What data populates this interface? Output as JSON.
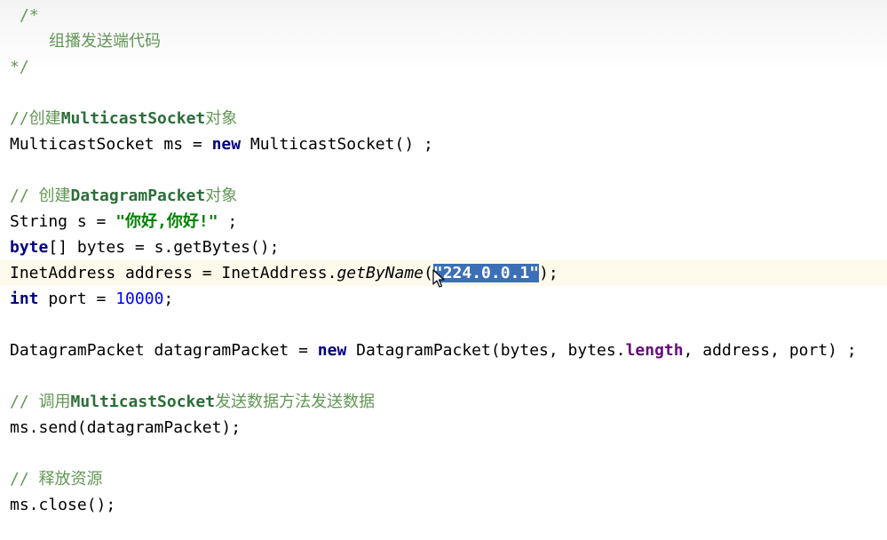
{
  "code": {
    "l1": "/*",
    "l2": "组播发送端代码",
    "l3": "*/",
    "l4_prefix": "//创建",
    "l4_id": "MulticastSocket",
    "l4_suffix": "对象",
    "l5_a": "MulticastSocket ms = ",
    "l5_kw": "new",
    "l5_b": " MulticastSocket() ;",
    "l6_prefix": "// 创建",
    "l6_id": "DatagramPacket",
    "l6_suffix": "对象",
    "l7_a": "String s = ",
    "l7_str": "\"你好,你好!\"",
    "l7_b": " ;",
    "l8_kw": "byte",
    "l8_b": "[] bytes = s.getBytes();",
    "l9_a": "InetAddress address = InetAddress.",
    "l9_fn": "getByName",
    "l9_open": "(",
    "l9_sel": "\"224.0.0.1\"",
    "l9_close": ");",
    "l10_kw": "int",
    "l10_a": " port = ",
    "l10_num": "10000",
    "l10_b": ";",
    "l11_a": "DatagramPacket datagramPacket = ",
    "l11_kw": "new",
    "l11_b": " DatagramPacket(bytes, bytes.",
    "l11_fld": "length",
    "l11_c": ", address, port) ;",
    "l12_prefix": "// 调用",
    "l12_id": "MulticastSocket",
    "l12_suffix": "发送数据方法发送数据",
    "l13": "ms.send(datagramPacket);",
    "l14": "// 释放资源",
    "l15": "ms.close();"
  }
}
